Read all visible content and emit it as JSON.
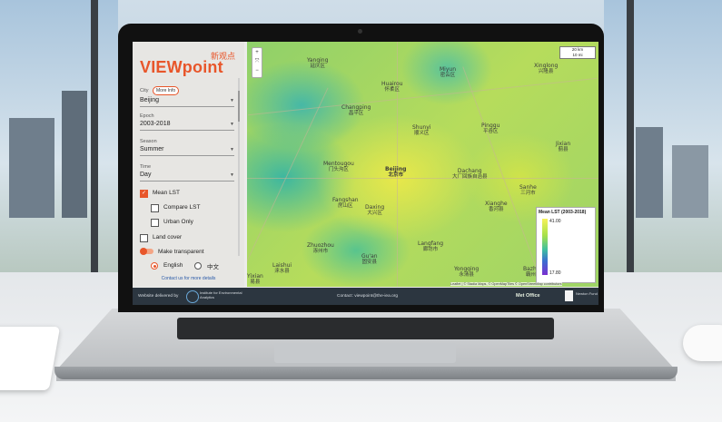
{
  "app": {
    "logo": "VIEWpoint",
    "logo_cn": "新观点"
  },
  "sidebar": {
    "city_label": "City",
    "more_info": "More Info",
    "city_value": "Beijing",
    "epoch_label": "Epoch",
    "epoch_value": "2003-2018",
    "season_label": "Season",
    "season_value": "Summer",
    "time_label": "Time",
    "time_value": "Day",
    "layers": {
      "mean_lst": {
        "label": "Mean LST",
        "checked": true
      },
      "compare_lst": {
        "label": "Compare LST",
        "checked": false
      },
      "urban_only": {
        "label": "Urban Only",
        "checked": false
      },
      "land_cover": {
        "label": "Land cover",
        "checked": false
      },
      "make_transparent": {
        "label": "Make transparent",
        "on": true
      }
    },
    "language": {
      "english": "English",
      "chinese": "中文",
      "selected": "English"
    },
    "contact_link": "Contact us for more details"
  },
  "map": {
    "zoom_in": "+",
    "fullscreen": "⤧",
    "zoom_out": "−",
    "scale_km": "20 km",
    "scale_mi": "10 mi",
    "places": [
      {
        "en": "Yanqing",
        "cn": "延庆区"
      },
      {
        "en": "Miyun",
        "cn": "密云区"
      },
      {
        "en": "Xinglong",
        "cn": "兴隆县"
      },
      {
        "en": "Huairou",
        "cn": "怀柔区"
      },
      {
        "en": "Changping",
        "cn": "昌平区"
      },
      {
        "en": "Shunyi",
        "cn": "顺义区"
      },
      {
        "en": "Pinggu",
        "cn": "平谷区"
      },
      {
        "en": "Mentougou",
        "cn": "门头沟区"
      },
      {
        "en": "Beijing",
        "cn": "北京市"
      },
      {
        "en": "Dachang",
        "cn": "大厂回族自治县"
      },
      {
        "en": "Jixian",
        "cn": "蓟县"
      },
      {
        "en": "Fangshan",
        "cn": "房山区"
      },
      {
        "en": "Daxing",
        "cn": "大兴区"
      },
      {
        "en": "Langfang",
        "cn": "廊坊市"
      },
      {
        "en": "Zhuozhou",
        "cn": "涿州市"
      },
      {
        "en": "Laishui",
        "cn": "涞水县"
      },
      {
        "en": "Gu'an",
        "cn": "固安县"
      },
      {
        "en": "Yongqing",
        "cn": "永清县"
      },
      {
        "en": "Yixian",
        "cn": "易县"
      },
      {
        "en": "Bazhou",
        "cn": "霸州市"
      },
      {
        "en": "Xianghe",
        "cn": "香河县"
      },
      {
        "en": "Sanhe",
        "cn": "三河市"
      },
      {
        "en": "Yongqing",
        "cn": "永清县"
      }
    ],
    "legend": {
      "title": "Mean LST (2003-2018)",
      "max": "41.00",
      "min": "17.80"
    },
    "attribution": "Leaflet | © Stadia Maps, © OpenMapTiles © OpenStreetMap contributors"
  },
  "footer": {
    "delivered_by": "Website delivered by",
    "institute": "Institute for Environmental Analytics",
    "contact": "Contact: viewpoint@the-iea.org",
    "met_office": "Met Office",
    "newton_fund": "Newton Fund"
  },
  "colors": {
    "accent": "#e8562a",
    "footer_bg": "#2c3640"
  }
}
